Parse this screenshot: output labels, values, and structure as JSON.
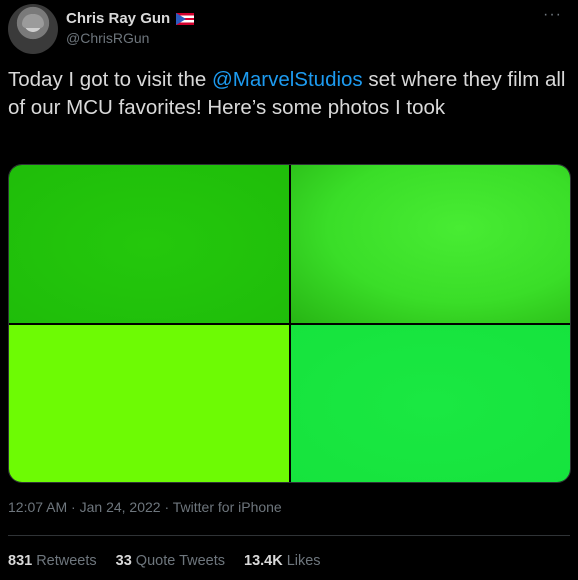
{
  "author": {
    "display_name": "Chris Ray Gun",
    "handle": "@ChrisRGun",
    "flag_icon": "puerto-rico-flag-icon"
  },
  "more_icon": "more-horizontal-icon",
  "tweet": {
    "text_before": "Today I got to visit the ",
    "mention": "@MarvelStudios",
    "text_after": " set where they film all of our MCU favorites! Here’s some photos I took"
  },
  "photos": [
    {
      "color": "#22c40b"
    },
    {
      "color": "#3ae029"
    },
    {
      "color": "#6dfb04"
    },
    {
      "color": "#18e640"
    }
  ],
  "meta": {
    "time": "12:07 AM",
    "date": "Jan 24, 2022",
    "source": "Twitter for iPhone",
    "separator": " · "
  },
  "stats": [
    {
      "num": "831",
      "label": "Retweets"
    },
    {
      "num": "33",
      "label": "Quote Tweets"
    },
    {
      "num": "13.4K",
      "label": "Likes"
    }
  ]
}
